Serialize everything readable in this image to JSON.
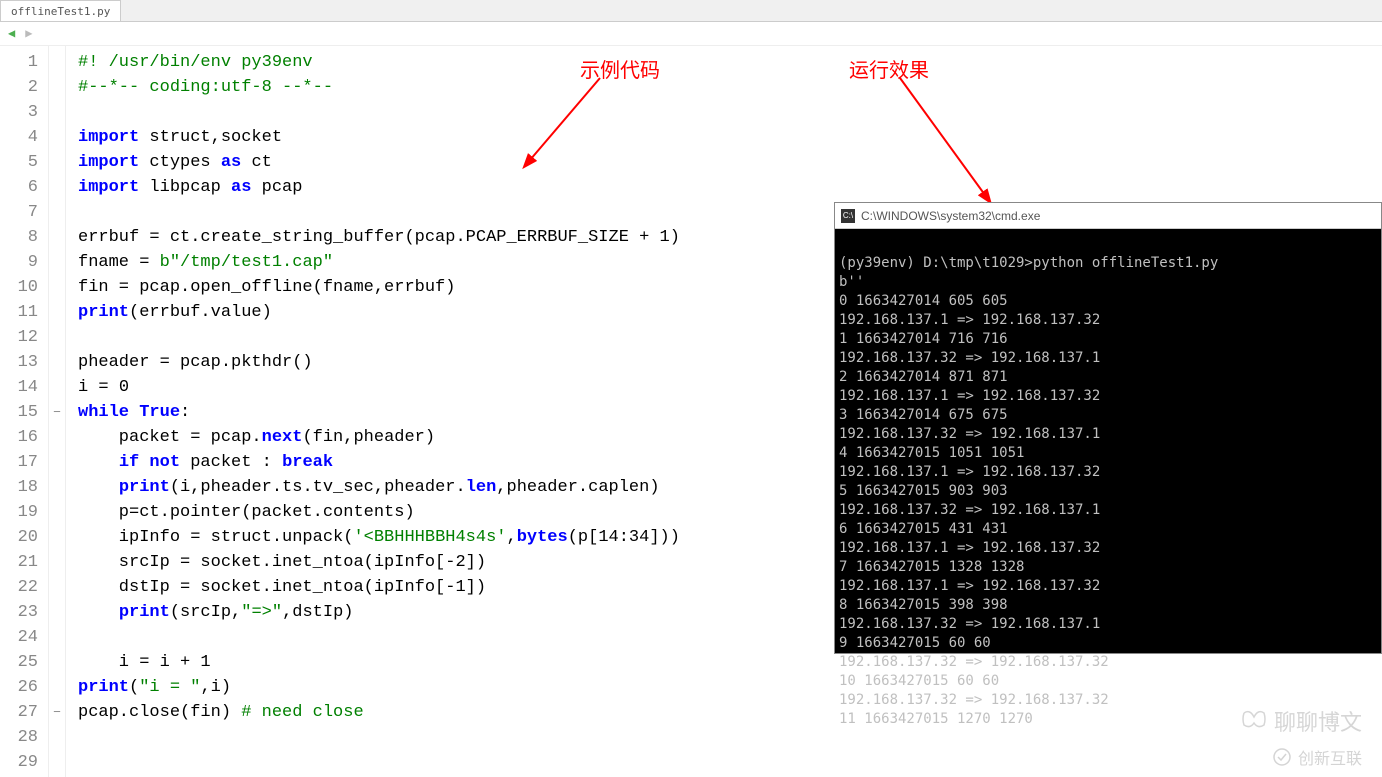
{
  "tab": {
    "filename": "offlineTest1.py"
  },
  "annotations": {
    "left_label": "示例代码",
    "right_label": "运行效果"
  },
  "code": {
    "lines": [
      {
        "n": 1,
        "seg": [
          [
            "#! /usr/bin/env py39env",
            "c-comment"
          ]
        ]
      },
      {
        "n": 2,
        "seg": [
          [
            "#--*-- coding:utf-8 --*--",
            "c-comment"
          ]
        ]
      },
      {
        "n": 3,
        "seg": [
          [
            "",
            ""
          ]
        ]
      },
      {
        "n": 4,
        "seg": [
          [
            "import",
            "c-kw"
          ],
          [
            " struct,socket",
            "c-name"
          ]
        ]
      },
      {
        "n": 5,
        "seg": [
          [
            "import",
            "c-kw"
          ],
          [
            " ctypes ",
            "c-name"
          ],
          [
            "as",
            "c-kw"
          ],
          [
            " ct",
            "c-name"
          ]
        ]
      },
      {
        "n": 6,
        "seg": [
          [
            "import",
            "c-kw"
          ],
          [
            " libpcap ",
            "c-name"
          ],
          [
            "as",
            "c-kw"
          ],
          [
            " pcap",
            "c-name"
          ]
        ]
      },
      {
        "n": 7,
        "seg": [
          [
            "",
            ""
          ]
        ]
      },
      {
        "n": 8,
        "seg": [
          [
            "errbuf = ct.create_string_buffer(pcap.PCAP_ERRBUF_SIZE + ",
            "c-name"
          ],
          [
            "1",
            "tok-num"
          ],
          [
            ")",
            "c-name"
          ]
        ]
      },
      {
        "n": 9,
        "seg": [
          [
            "fname = ",
            "c-name"
          ],
          [
            "b\"/tmp/test1.cap\"",
            "c-str"
          ]
        ]
      },
      {
        "n": 10,
        "seg": [
          [
            "fin = pcap.open_offline(fname,errbuf)",
            "c-name"
          ]
        ]
      },
      {
        "n": 11,
        "seg": [
          [
            "print",
            "c-kw"
          ],
          [
            "(errbuf.value)",
            "c-name"
          ]
        ]
      },
      {
        "n": 12,
        "seg": [
          [
            "",
            ""
          ]
        ]
      },
      {
        "n": 13,
        "seg": [
          [
            "pheader = pcap.pkthdr()",
            "c-name"
          ]
        ]
      },
      {
        "n": 14,
        "seg": [
          [
            "i = ",
            "c-name"
          ],
          [
            "0",
            "tok-num"
          ]
        ]
      },
      {
        "n": 15,
        "fold": "-",
        "seg": [
          [
            "while True",
            "c-kw"
          ],
          [
            ":",
            "c-name"
          ]
        ]
      },
      {
        "n": 16,
        "seg": [
          [
            "    packet = pcap.",
            "c-name"
          ],
          [
            "next",
            "c-kw"
          ],
          [
            "(fin,pheader)",
            "c-name"
          ]
        ]
      },
      {
        "n": 17,
        "seg": [
          [
            "    ",
            "c-name"
          ],
          [
            "if not",
            "c-kw"
          ],
          [
            " packet : ",
            "c-name"
          ],
          [
            "break",
            "c-kw"
          ]
        ]
      },
      {
        "n": 18,
        "seg": [
          [
            "    ",
            "c-name"
          ],
          [
            "print",
            "c-kw"
          ],
          [
            "(i,pheader.ts.tv_sec,pheader.",
            "c-name"
          ],
          [
            "len",
            "c-kw"
          ],
          [
            ",pheader.caplen)",
            "c-name"
          ]
        ]
      },
      {
        "n": 19,
        "seg": [
          [
            "    p=ct.pointer(packet.contents)",
            "c-name"
          ]
        ]
      },
      {
        "n": 20,
        "seg": [
          [
            "    ipInfo = struct.unpack(",
            "c-name"
          ],
          [
            "'<BBHHHBBH4s4s'",
            "c-str"
          ],
          [
            ",",
            "c-name"
          ],
          [
            "bytes",
            "c-kw"
          ],
          [
            "(p[",
            "c-name"
          ],
          [
            "14",
            "tok-num"
          ],
          [
            ":",
            "c-name"
          ],
          [
            "34",
            "tok-num"
          ],
          [
            "]))",
            "c-name"
          ]
        ]
      },
      {
        "n": 21,
        "seg": [
          [
            "    srcIp = socket.inet_ntoa(ipInfo[-",
            "c-name"
          ],
          [
            "2",
            "tok-num"
          ],
          [
            "])",
            "c-name"
          ]
        ]
      },
      {
        "n": 22,
        "seg": [
          [
            "    dstIp = socket.inet_ntoa(ipInfo[-",
            "c-name"
          ],
          [
            "1",
            "tok-num"
          ],
          [
            "])",
            "c-name"
          ]
        ]
      },
      {
        "n": 23,
        "seg": [
          [
            "    ",
            "c-name"
          ],
          [
            "print",
            "c-kw"
          ],
          [
            "(srcIp,",
            "c-name"
          ],
          [
            "\"=>\"",
            "c-str"
          ],
          [
            ",dstIp)",
            "c-name"
          ]
        ]
      },
      {
        "n": 24,
        "seg": [
          [
            "",
            ""
          ]
        ]
      },
      {
        "n": 25,
        "seg": [
          [
            "    i = i + ",
            "c-name"
          ],
          [
            "1",
            "tok-num"
          ]
        ]
      },
      {
        "n": 26,
        "seg": [
          [
            "print",
            "c-kw"
          ],
          [
            "(",
            "c-name"
          ],
          [
            "\"i = \"",
            "c-str"
          ],
          [
            ",i)",
            "c-name"
          ]
        ]
      },
      {
        "n": 27,
        "fold": "-",
        "seg": [
          [
            "pcap.close(fin) ",
            "c-name"
          ],
          [
            "# need close",
            "c-comment"
          ]
        ]
      },
      {
        "n": 28,
        "seg": [
          [
            "",
            ""
          ]
        ]
      },
      {
        "n": 29,
        "seg": [
          [
            "",
            ""
          ]
        ]
      }
    ]
  },
  "terminal": {
    "title": "C:\\WINDOWS\\system32\\cmd.exe",
    "icon_text": "C:\\",
    "lines": [
      "",
      "(py39env) D:\\tmp\\t1029>python offlineTest1.py",
      "b''",
      "0 1663427014 605 605",
      "192.168.137.1 => 192.168.137.32",
      "1 1663427014 716 716",
      "192.168.137.32 => 192.168.137.1",
      "2 1663427014 871 871",
      "192.168.137.1 => 192.168.137.32",
      "3 1663427014 675 675",
      "192.168.137.32 => 192.168.137.1",
      "4 1663427015 1051 1051",
      "192.168.137.1 => 192.168.137.32",
      "5 1663427015 903 903",
      "192.168.137.32 => 192.168.137.1",
      "6 1663427015 431 431",
      "192.168.137.1 => 192.168.137.32",
      "7 1663427015 1328 1328",
      "192.168.137.1 => 192.168.137.32",
      "8 1663427015 398 398",
      "192.168.137.32 => 192.168.137.1",
      "9 1663427015 60 60",
      "192.168.137.32 => 192.168.137.32",
      "10 1663427015 60 60",
      "192.168.137.32 => 192.168.137.32",
      "11 1663427015 1270 1270"
    ]
  },
  "watermarks": {
    "w1": "聊聊博文",
    "w2": "创新互联"
  }
}
